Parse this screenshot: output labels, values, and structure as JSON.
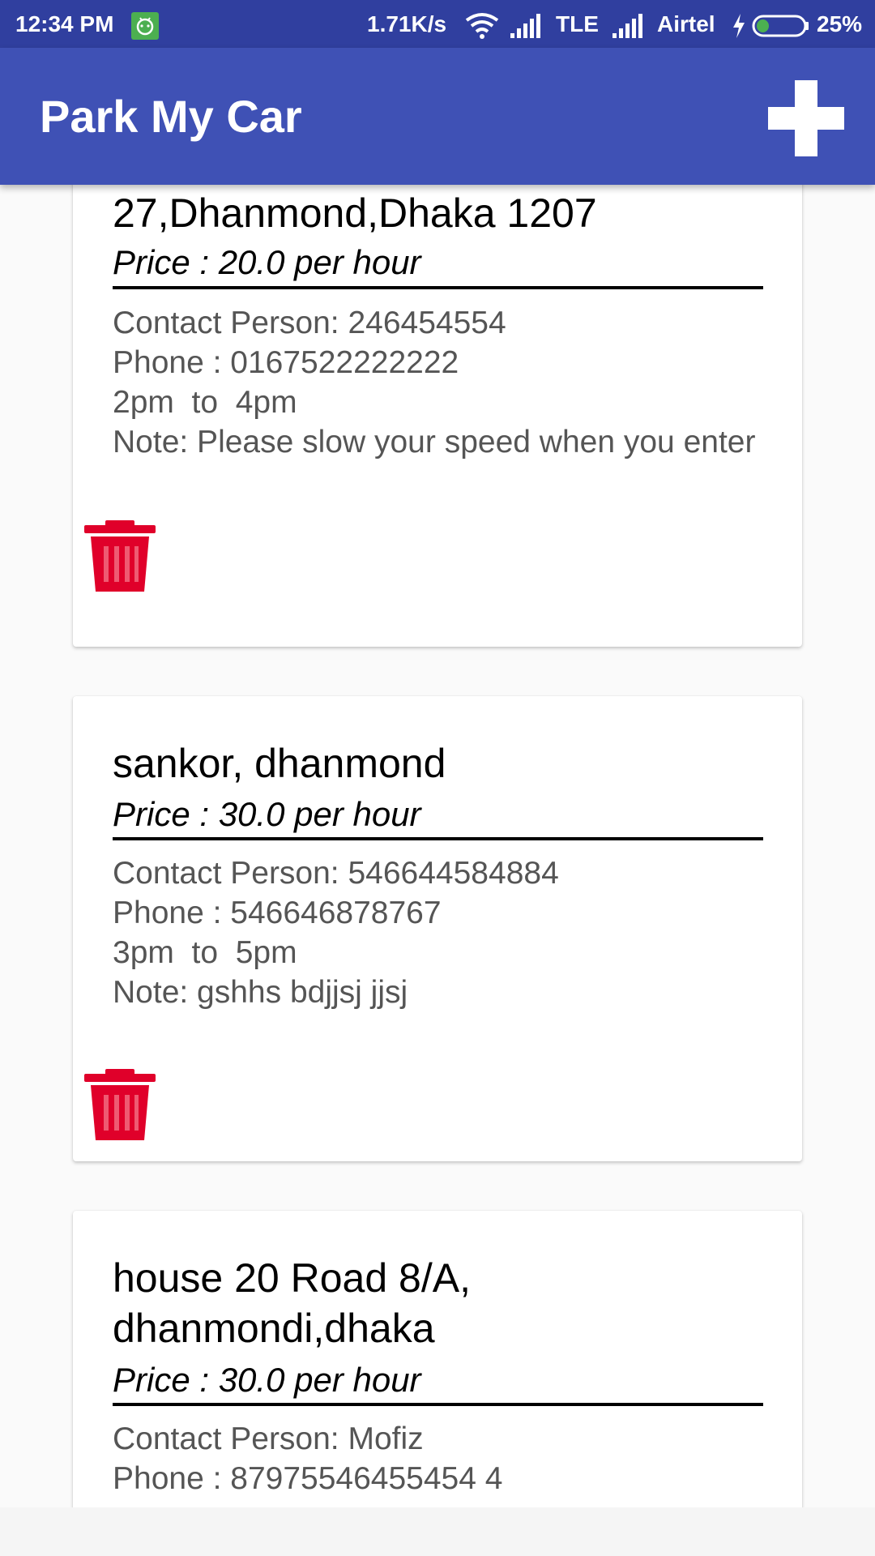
{
  "status_bar": {
    "time": "12:34 PM",
    "network_speed": "1.71K/s",
    "network_type": "TLE",
    "carrier": "Airtel",
    "battery": "25%",
    "notification_icon": "android-icon"
  },
  "app_bar": {
    "title": "Park My Car",
    "add_icon": "plus-icon"
  },
  "colors": {
    "status_bar": "#303f9f",
    "app_bar": "#3f51b5",
    "delete_icon": "#e0002a"
  },
  "cards": [
    {
      "address": "27,Dhanmond,Dhaka 1207",
      "price": "Price : 20.0 per hour",
      "contact": "Contact Person: 246454554",
      "phone": "Phone : 0167522222222",
      "time": "2pm  to  4pm",
      "note": "Note: Please slow your speed when you enter"
    },
    {
      "address": "sankor, dhanmond",
      "price": "Price : 30.0 per hour",
      "contact": "Contact Person: 546644584884",
      "phone": "Phone : 546646878767",
      "time": "3pm  to  5pm",
      "note": "Note: gshhs bdjjsj jjsj"
    },
    {
      "address": "house 20 Road 8/A, dhanmondi,dhaka",
      "price": "Price : 30.0 per hour",
      "contact": "Contact Person: Mofiz",
      "phone": "Phone : 87975546455454 4"
    }
  ]
}
